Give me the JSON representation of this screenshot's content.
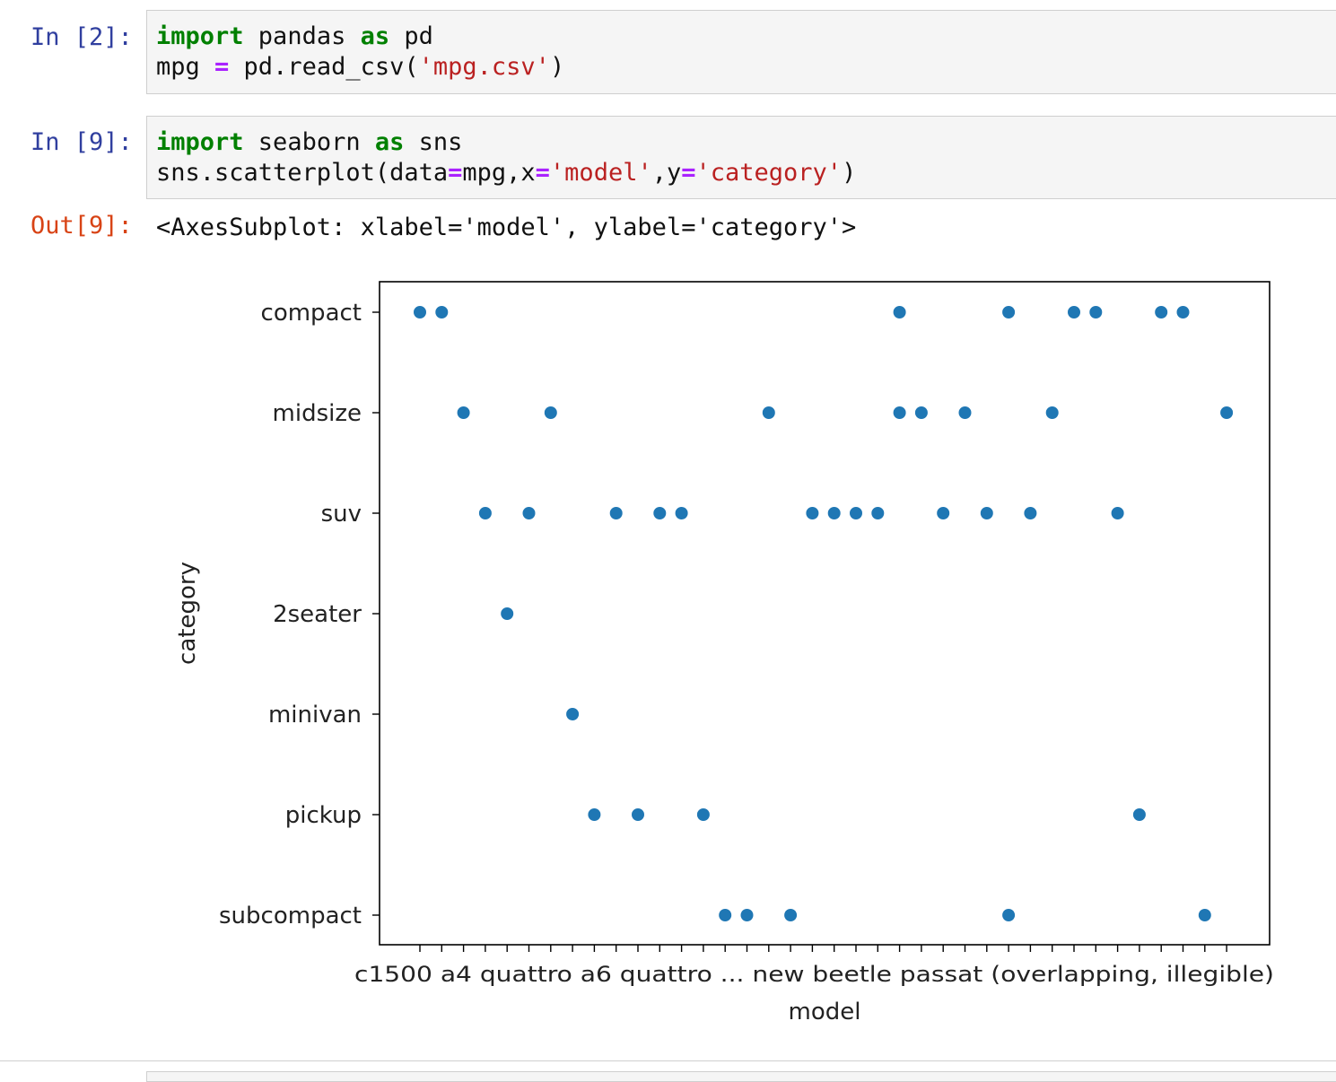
{
  "cells": [
    {
      "prompt": "In [2]:",
      "lines": [
        [
          {
            "t": "import",
            "c": "kw"
          },
          {
            "t": " pandas "
          },
          {
            "t": "as",
            "c": "kw"
          },
          {
            "t": " pd"
          }
        ],
        [
          {
            "t": "mpg "
          },
          {
            "t": "=",
            "c": "op"
          },
          {
            "t": " pd.read_csv("
          },
          {
            "t": "'mpg.csv'",
            "c": "str"
          },
          {
            "t": ")"
          }
        ]
      ]
    },
    {
      "prompt": "In [9]:",
      "lines": [
        [
          {
            "t": "import",
            "c": "kw"
          },
          {
            "t": " seaborn "
          },
          {
            "t": "as",
            "c": "kw"
          },
          {
            "t": " sns"
          }
        ],
        [
          {
            "t": "sns.scatterplot(data"
          },
          {
            "t": "=",
            "c": "op"
          },
          {
            "t": "mpg,x"
          },
          {
            "t": "=",
            "c": "op"
          },
          {
            "t": "'model'",
            "c": "str"
          },
          {
            "t": ",y"
          },
          {
            "t": "=",
            "c": "op"
          },
          {
            "t": "'category'",
            "c": "str"
          },
          {
            "t": ")"
          }
        ]
      ]
    }
  ],
  "output": {
    "prompt": "Out[9]:",
    "text": "<AxesSubplot: xlabel='model', ylabel='category'>"
  },
  "chart_data": {
    "type": "scatter",
    "xlabel": "model",
    "ylabel": "category",
    "categories_y": [
      "compact",
      "midsize",
      "suv",
      "2seater",
      "minivan",
      "pickup",
      "subcompact"
    ],
    "x_tick_count": 38,
    "x_tick_text": "c1500 a4 quattro a6 quattro ... new beetle passat (overlapping, illegible)",
    "points": [
      {
        "x": 0,
        "y": "compact"
      },
      {
        "x": 1,
        "y": "compact"
      },
      {
        "x": 2,
        "y": "midsize"
      },
      {
        "x": 3,
        "y": "suv"
      },
      {
        "x": 4,
        "y": "2seater"
      },
      {
        "x": 5,
        "y": "suv"
      },
      {
        "x": 6,
        "y": "midsize"
      },
      {
        "x": 7,
        "y": "minivan"
      },
      {
        "x": 8,
        "y": "pickup"
      },
      {
        "x": 9,
        "y": "suv"
      },
      {
        "x": 10,
        "y": "pickup"
      },
      {
        "x": 11,
        "y": "suv"
      },
      {
        "x": 12,
        "y": "suv"
      },
      {
        "x": 13,
        "y": "pickup"
      },
      {
        "x": 14,
        "y": "subcompact"
      },
      {
        "x": 15,
        "y": "subcompact"
      },
      {
        "x": 16,
        "y": "midsize"
      },
      {
        "x": 17,
        "y": "subcompact"
      },
      {
        "x": 18,
        "y": "suv"
      },
      {
        "x": 19,
        "y": "suv"
      },
      {
        "x": 20,
        "y": "suv"
      },
      {
        "x": 21,
        "y": "suv"
      },
      {
        "x": 22,
        "y": "compact"
      },
      {
        "x": 22,
        "y": "midsize"
      },
      {
        "x": 23,
        "y": "midsize"
      },
      {
        "x": 24,
        "y": "suv"
      },
      {
        "x": 25,
        "y": "midsize"
      },
      {
        "x": 26,
        "y": "suv"
      },
      {
        "x": 27,
        "y": "compact"
      },
      {
        "x": 27,
        "y": "subcompact"
      },
      {
        "x": 28,
        "y": "suv"
      },
      {
        "x": 29,
        "y": "midsize"
      },
      {
        "x": 30,
        "y": "compact"
      },
      {
        "x": 31,
        "y": "compact"
      },
      {
        "x": 32,
        "y": "suv"
      },
      {
        "x": 33,
        "y": "pickup"
      },
      {
        "x": 34,
        "y": "compact"
      },
      {
        "x": 35,
        "y": "compact"
      },
      {
        "x": 36,
        "y": "subcompact"
      },
      {
        "x": 37,
        "y": "midsize"
      }
    ],
    "marker_color": "#1f77b4",
    "grid": false,
    "legend": "none"
  }
}
